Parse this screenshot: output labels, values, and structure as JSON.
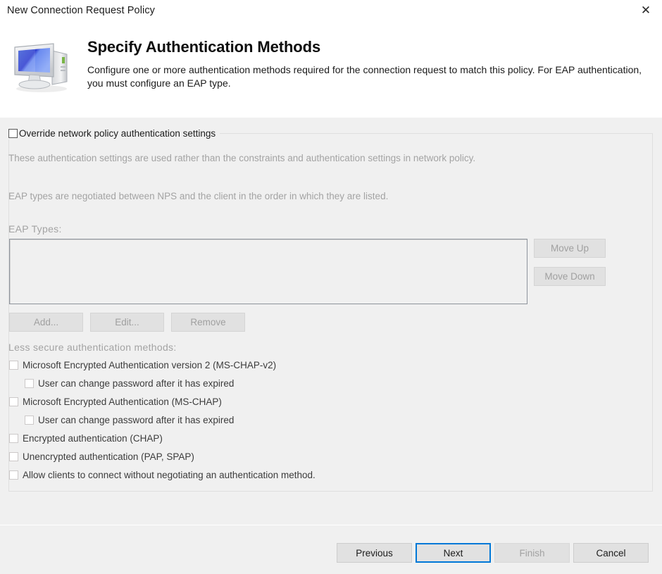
{
  "window": {
    "title": "New Connection Request Policy",
    "close_icon": "close-icon"
  },
  "header": {
    "icon": "computer-monitor-icon",
    "title": "Specify Authentication Methods",
    "description": "Configure one or more authentication methods required for the connection request to match this policy. For EAP authentication, you must configure an EAP type."
  },
  "body": {
    "override_group": {
      "legend_label": "Override network policy authentication settings",
      "legend_checked": false,
      "note_1": "These authentication settings are used rather than the constraints and authentication settings in network policy.",
      "note_2": "EAP types are negotiated between NPS and the client in the order in which they are listed.",
      "eap_types_label": "EAP Types:",
      "eap_types_items": [],
      "side_buttons": [
        {
          "label": "Move Up",
          "name": "move-up-button",
          "disabled": true
        },
        {
          "label": "Move Down",
          "name": "move-down-button",
          "disabled": true
        }
      ],
      "list_buttons": [
        {
          "label": "Add...",
          "name": "add-button",
          "disabled": true
        },
        {
          "label": "Edit...",
          "name": "edit-button",
          "disabled": true
        },
        {
          "label": "Remove",
          "name": "remove-button",
          "disabled": true
        }
      ],
      "less_secure_label": "Less secure authentication methods:",
      "methods": [
        {
          "label": "Microsoft Encrypted Authentication version 2 (MS-CHAP-v2)",
          "checked": false,
          "indent": 0
        },
        {
          "label": "User can change password after it has expired",
          "checked": false,
          "indent": 1
        },
        {
          "label": "Microsoft Encrypted Authentication (MS-CHAP)",
          "checked": false,
          "indent": 0
        },
        {
          "label": "User can change password after it has expired",
          "checked": false,
          "indent": 1
        },
        {
          "label": "Encrypted authentication (CHAP)",
          "checked": false,
          "indent": 0
        },
        {
          "label": "Unencrypted authentication (PAP, SPAP)",
          "checked": false,
          "indent": 0
        },
        {
          "label": "Allow clients to connect without negotiating an authentication method.",
          "checked": false,
          "indent": 0
        }
      ]
    }
  },
  "footer": {
    "buttons": [
      {
        "label": "Previous",
        "name": "previous-button",
        "state": "normal"
      },
      {
        "label": "Next",
        "name": "next-button",
        "state": "default"
      },
      {
        "label": "Finish",
        "name": "finish-button",
        "state": "disabled"
      },
      {
        "label": "Cancel",
        "name": "cancel-button",
        "state": "normal"
      }
    ]
  },
  "colors": {
    "accent": "#0078d7",
    "window_bg": "#f0f0f0",
    "header_bg": "#ffffff",
    "disabled_text": "#a0a0a0"
  }
}
